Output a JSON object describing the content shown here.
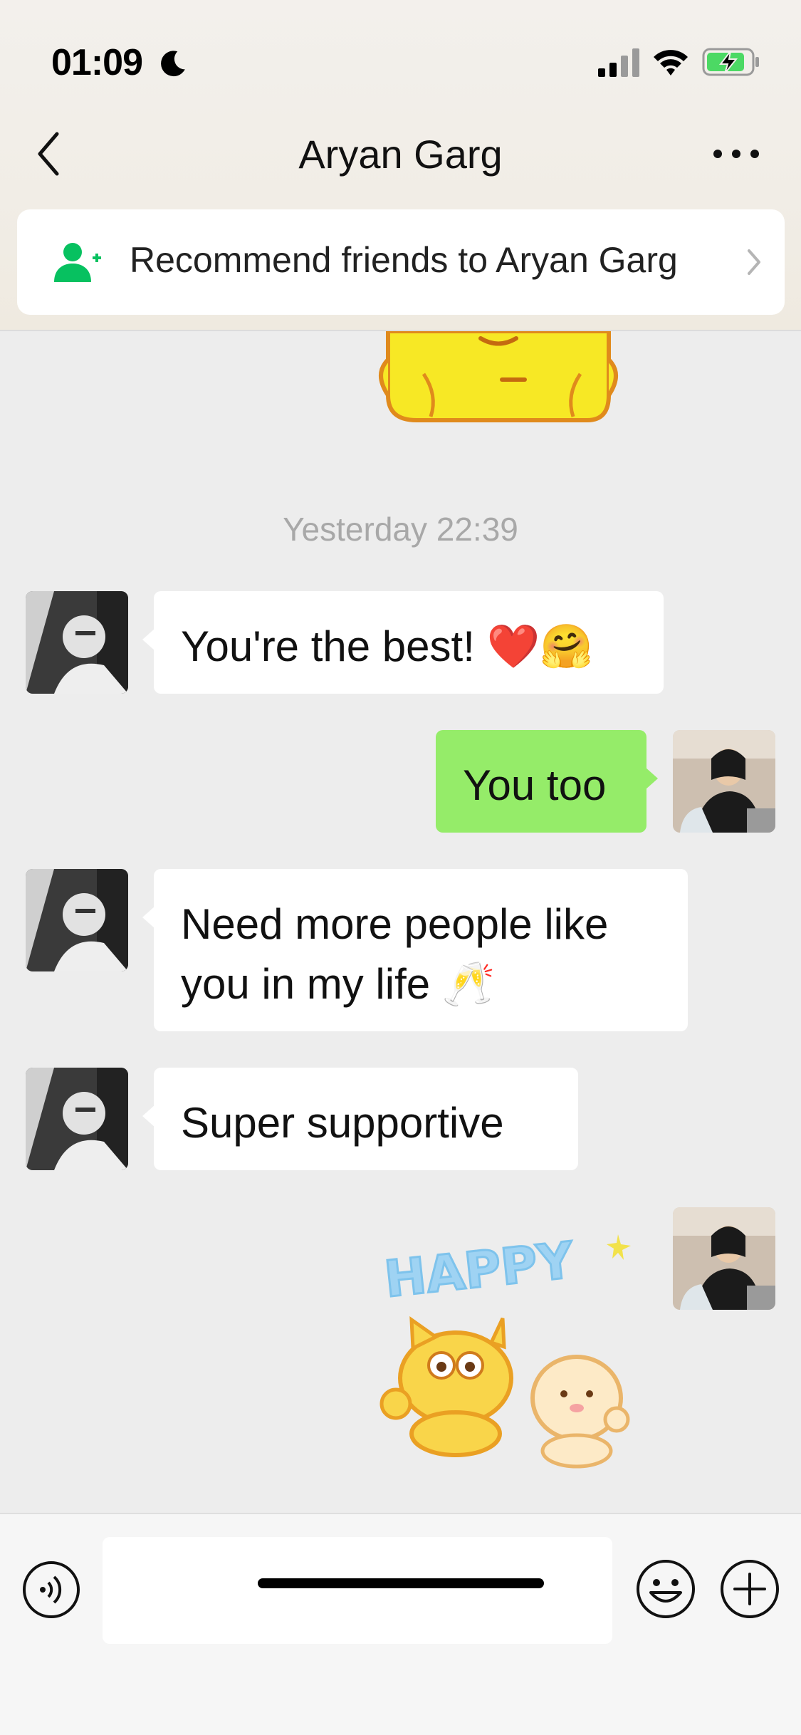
{
  "status_bar": {
    "time": "01:09"
  },
  "nav": {
    "title": "Aryan Garg"
  },
  "recommend_banner": {
    "label": "Recommend friends to Aryan Garg"
  },
  "timestamp": "Yesterday 22:39",
  "messages": [
    {
      "direction": "in",
      "text": "You're the best!",
      "emojis": "❤️🤗"
    },
    {
      "direction": "out",
      "text": "You too"
    },
    {
      "direction": "in",
      "line1": "Need more people like",
      "line2": "you in my life",
      "emojis": "🥂"
    },
    {
      "direction": "in",
      "text": "Super supportive"
    },
    {
      "direction": "out",
      "sticker": "HAPPY"
    }
  ],
  "colors": {
    "outgoing_bubble": "#95ec69",
    "incoming_bubble": "#ffffff",
    "chat_background": "#ededed",
    "accent_green": "#07c160"
  },
  "icons": [
    "moon-icon",
    "signal-icon",
    "wifi-icon",
    "battery-charging-icon",
    "back-chevron-icon",
    "more-icon",
    "add-friend-icon",
    "chevron-right-icon",
    "voice-icon",
    "emoji-icon",
    "plus-icon"
  ]
}
